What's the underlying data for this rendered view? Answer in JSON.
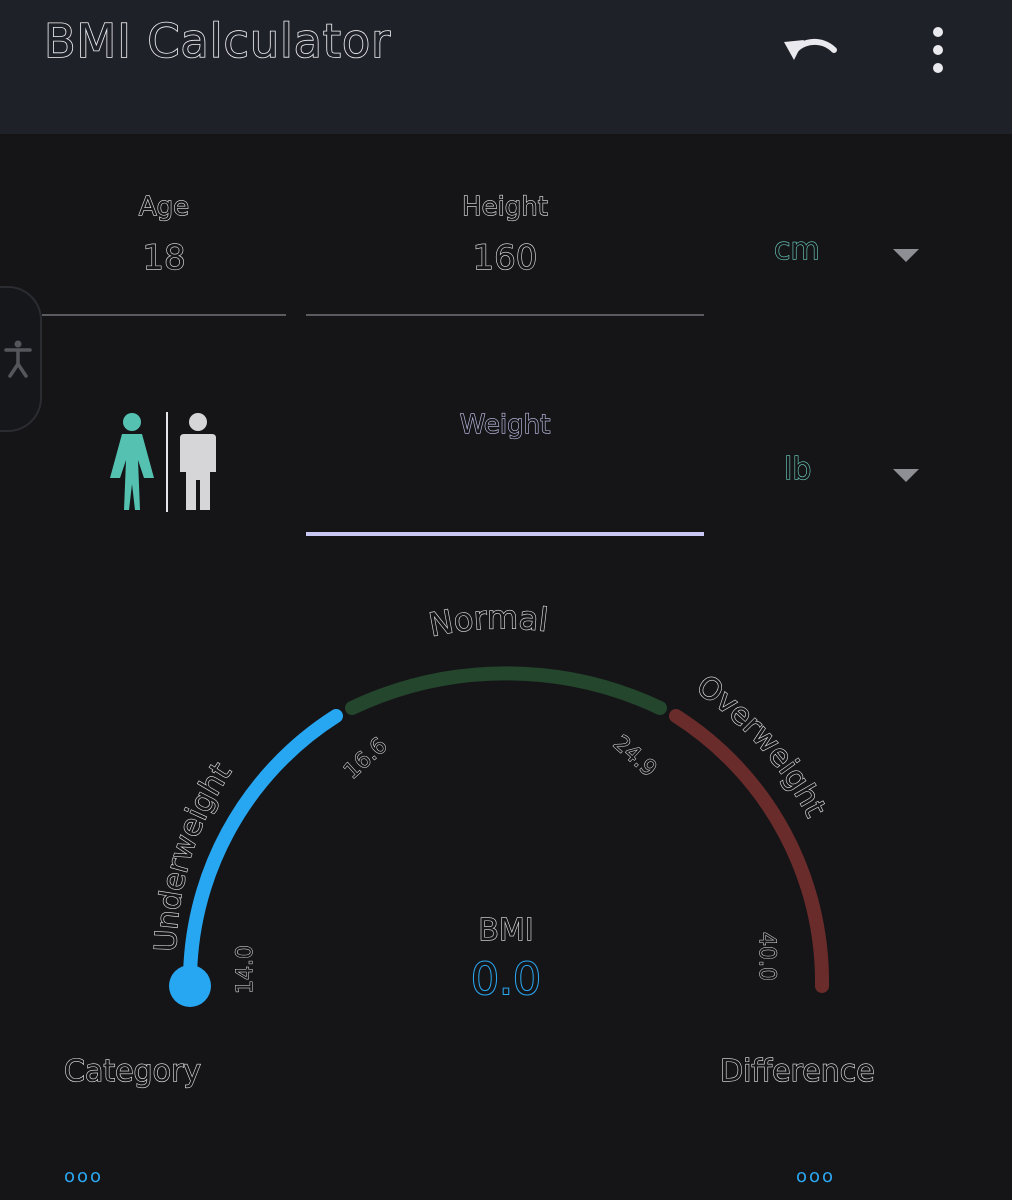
{
  "appbar": {
    "title": "BMI Calculator",
    "undo_icon": "undo-icon",
    "menu_icon": "more-vert-icon"
  },
  "form": {
    "age": {
      "label": "Age",
      "value": "18"
    },
    "height": {
      "label": "Height",
      "value": "160",
      "unit": "cm"
    },
    "weight": {
      "label": "Weight",
      "value": "",
      "unit": "lb"
    },
    "gender": {
      "female_icon": "female-icon",
      "male_icon": "male-icon",
      "selected": "female"
    }
  },
  "gauge": {
    "categories": [
      "Underweight",
      "Normal",
      "Overweight"
    ],
    "ticks": [
      "14.0",
      "16.6",
      "24.9",
      "40.0"
    ],
    "bmi_label": "BMI",
    "bmi_value": "0.0"
  },
  "results": {
    "category_label": "Category",
    "category_value": "ooo",
    "difference_label": "Difference",
    "difference_value": "ooo"
  },
  "colors": {
    "underweight": "#27a7f2",
    "normal": "#24462d",
    "overweight": "#6a2b2b",
    "accent_teal": "#55c2b1",
    "weight_underline": "#c9c8f2"
  }
}
